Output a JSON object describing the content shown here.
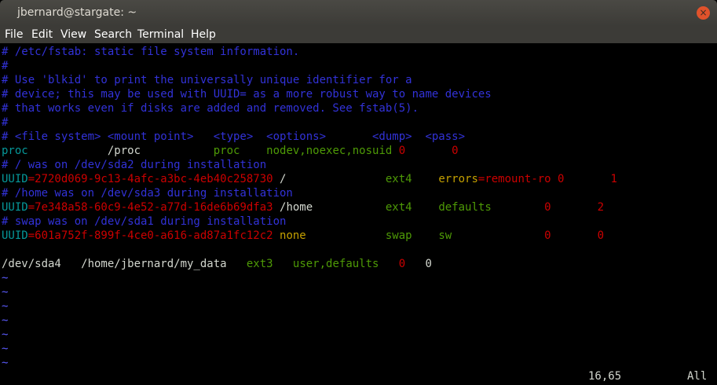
{
  "window": {
    "title": "jbernard@stargate: ~",
    "close_glyph": "×"
  },
  "menu": [
    "File",
    "Edit",
    "View",
    "Search",
    "Terminal",
    "Help"
  ],
  "lines": [
    [
      {
        "t": "# /etc/fstab: static file system information.",
        "c": "comment"
      }
    ],
    [
      {
        "t": "#",
        "c": "comment"
      }
    ],
    [
      {
        "t": "# Use 'blkid' to print the universally unique identifier for a",
        "c": "comment"
      }
    ],
    [
      {
        "t": "# device; this may be used with UUID= as a more robust way to name devices",
        "c": "comment"
      }
    ],
    [
      {
        "t": "# that works even if disks are added and removed. See fstab(5).",
        "c": "comment"
      }
    ],
    [
      {
        "t": "#",
        "c": "comment"
      }
    ],
    [
      {
        "t": "# <file system> <mount point>   <type>  <options>       <dump>  <pass>",
        "c": "comment"
      }
    ],
    [
      {
        "t": "proc            ",
        "c": "cyan"
      },
      {
        "t": "/proc           ",
        "c": "white"
      },
      {
        "t": "proc    ",
        "c": "green"
      },
      {
        "t": "nodev,noexec,nosuid ",
        "c": "green"
      },
      {
        "t": "0       ",
        "c": "red"
      },
      {
        "t": "0",
        "c": "red"
      }
    ],
    [
      {
        "t": "# / was on /dev/sda2 during installation",
        "c": "comment"
      }
    ],
    [
      {
        "t": "UUID",
        "c": "cyan"
      },
      {
        "t": "=2720d069-9c13-4afc-a3bc-4eb40c258730 ",
        "c": "red"
      },
      {
        "t": "/               ",
        "c": "white"
      },
      {
        "t": "ext4    ",
        "c": "green"
      },
      {
        "t": "errors",
        "c": "orange"
      },
      {
        "t": "=remount-ro ",
        "c": "red"
      },
      {
        "t": "0       ",
        "c": "red"
      },
      {
        "t": "1",
        "c": "red"
      }
    ],
    [
      {
        "t": "# /home was on /dev/sda3 during installation",
        "c": "comment"
      }
    ],
    [
      {
        "t": "UUID",
        "c": "cyan"
      },
      {
        "t": "=7e348a58-60c9-4e52-a77d-16de6b69dfa3 ",
        "c": "red"
      },
      {
        "t": "/home           ",
        "c": "white"
      },
      {
        "t": "ext4    ",
        "c": "green"
      },
      {
        "t": "defaults        ",
        "c": "green"
      },
      {
        "t": "0       ",
        "c": "red"
      },
      {
        "t": "2",
        "c": "red"
      }
    ],
    [
      {
        "t": "# swap was on /dev/sda1 during installation",
        "c": "comment"
      }
    ],
    [
      {
        "t": "UUID",
        "c": "cyan"
      },
      {
        "t": "=601a752f-899f-4ce0-a616-ad87a1fc12c2 ",
        "c": "red"
      },
      {
        "t": "none            ",
        "c": "orange"
      },
      {
        "t": "swap    ",
        "c": "green"
      },
      {
        "t": "sw              ",
        "c": "green"
      },
      {
        "t": "0       ",
        "c": "red"
      },
      {
        "t": "0",
        "c": "red"
      }
    ],
    [
      {
        "t": "",
        "c": "white"
      }
    ],
    [
      {
        "t": "/dev/sda4   /home/jbernard/my_data   ",
        "c": "white"
      },
      {
        "t": "ext3   ",
        "c": "green"
      },
      {
        "t": "user,defaults   ",
        "c": "green"
      },
      {
        "t": "0   ",
        "c": "red"
      },
      {
        "t": "0",
        "c": "cursor"
      }
    ],
    [
      {
        "t": "~",
        "c": "tilde"
      }
    ],
    [
      {
        "t": "~",
        "c": "tilde"
      }
    ],
    [
      {
        "t": "~",
        "c": "tilde"
      }
    ],
    [
      {
        "t": "~",
        "c": "tilde"
      }
    ],
    [
      {
        "t": "~",
        "c": "tilde"
      }
    ],
    [
      {
        "t": "~",
        "c": "tilde"
      }
    ],
    [
      {
        "t": "~",
        "c": "tilde"
      }
    ]
  ],
  "status": {
    "position": "16,65",
    "view": "All"
  }
}
